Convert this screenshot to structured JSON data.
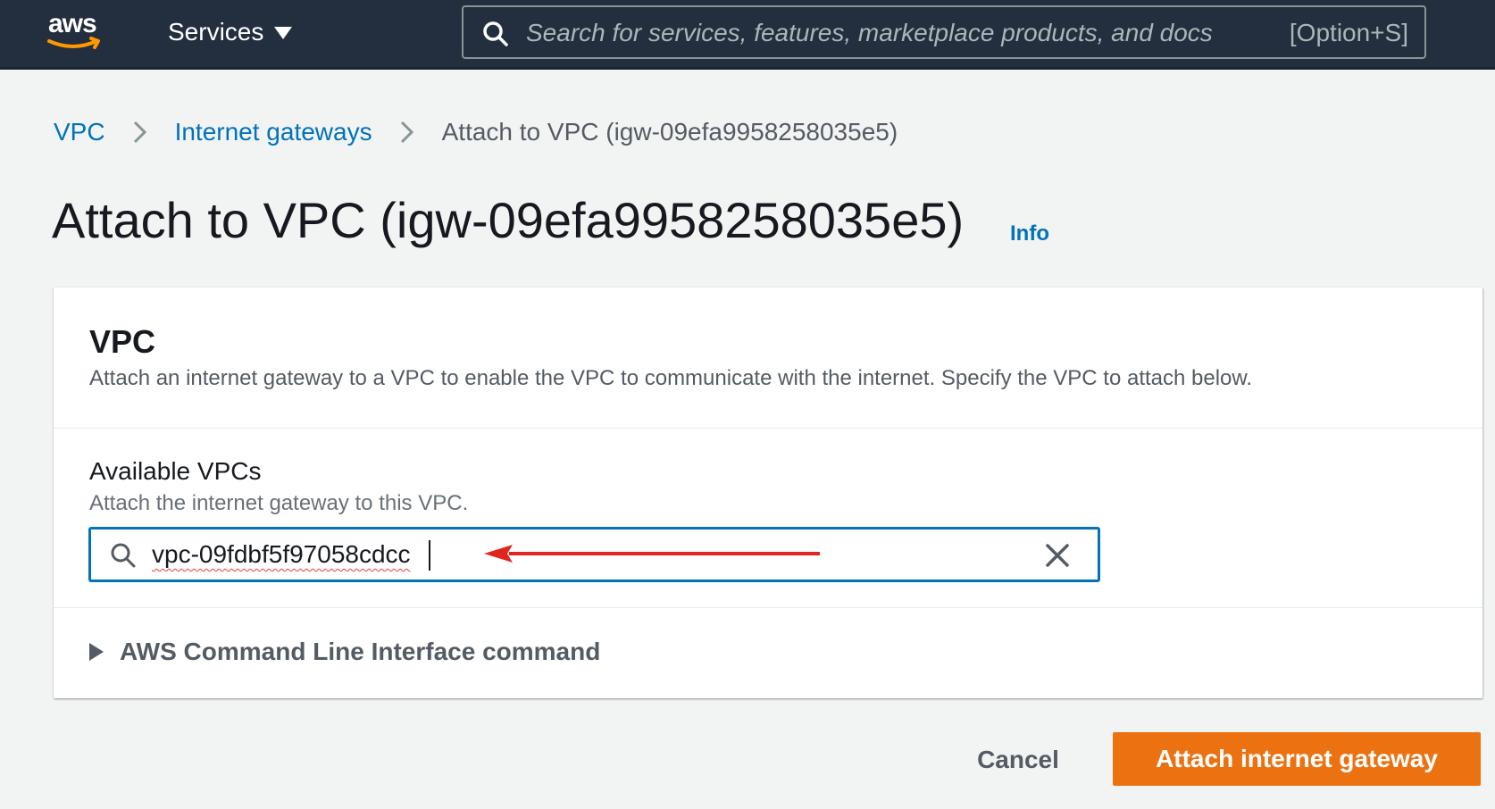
{
  "topnav": {
    "logo_text": "aws",
    "services_label": "Services",
    "search_placeholder": "Search for services, features, marketplace products, and docs",
    "search_shortcut": "[Option+S]"
  },
  "breadcrumb": {
    "items": [
      "VPC",
      "Internet gateways"
    ],
    "current": "Attach to VPC (igw-09efa9958258035e5)"
  },
  "page": {
    "title": "Attach to VPC (igw-09efa9958258035e5)",
    "info_label": "Info"
  },
  "panel": {
    "title": "VPC",
    "description": "Attach an internet gateway to a VPC to enable the VPC to communicate with the internet. Specify the VPC to attach below.",
    "field_label": "Available VPCs",
    "field_description": "Attach the internet gateway to this VPC.",
    "field_value": "vpc-09fdbf5f97058cdcc",
    "cli_label": "AWS Command Line Interface command"
  },
  "footer": {
    "cancel_label": "Cancel",
    "submit_label": "Attach internet gateway"
  },
  "colors": {
    "nav_bg": "#232f3e",
    "link": "#0073bb",
    "primary": "#ec7211",
    "annotation_arrow": "#e0261f"
  }
}
